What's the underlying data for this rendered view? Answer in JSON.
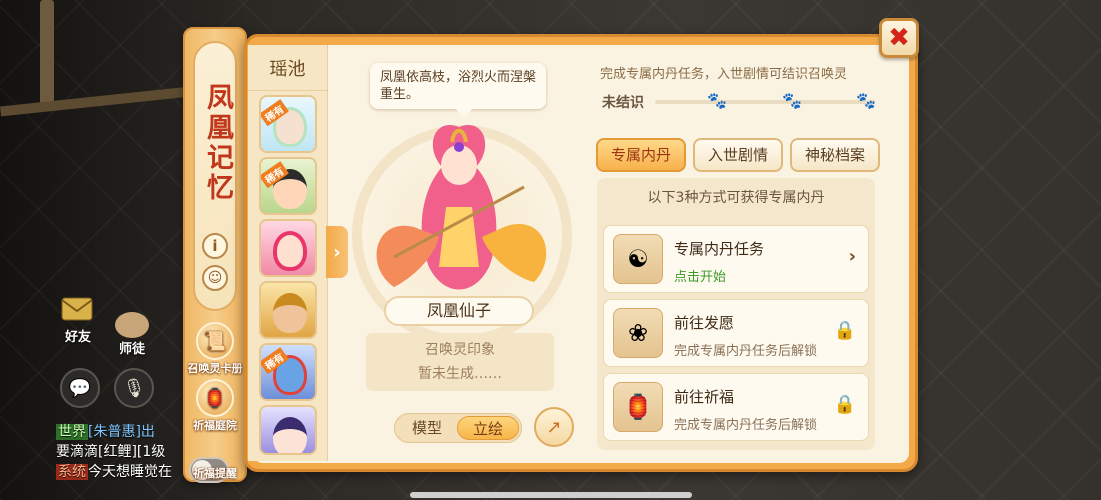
{
  "ribbon": {
    "title": "凤凰记忆",
    "info_icon": "i",
    "smile_icon": "☺",
    "card_label": "召唤灵卡册",
    "courtyard_label": "祈福庭院",
    "remind_label": "祈福提醒"
  },
  "pet_list": {
    "header": "瑶池",
    "rare_badge": "稀有"
  },
  "character": {
    "quote": "凤凰依高枝，浴烈火而涅槃重生。",
    "name": "凤凰仙子",
    "seal_title": "召唤灵印象",
    "seal_status": "暂未生成……",
    "view_model": "模型",
    "view_art": "立绘"
  },
  "bond": {
    "hint": "完成专属内丹任务，入世剧情可结识召唤灵",
    "state": "未结识"
  },
  "tabs": [
    "专属内丹",
    "入世剧情",
    "神秘档案"
  ],
  "methods": {
    "title": "以下3种方式可获得专属内丹",
    "items": [
      {
        "title": "专属内丹任务",
        "sub": "点击开始",
        "icon": "☯"
      },
      {
        "title": "前往发愿",
        "sub": "完成专属内丹任务后解锁",
        "icon": "❀"
      },
      {
        "title": "前往祈福",
        "sub": "完成专属内丹任务后解锁",
        "icon": "🏮"
      }
    ]
  },
  "hud": {
    "friends": "好友",
    "master": "师徒",
    "world_tag": "世界",
    "chat1": "[朱普惠]出",
    "chat2": "要滴滴[红鲤][1级",
    "system_tag": "系统",
    "chat3": "今天想睡觉在"
  },
  "colors": {
    "accent": "#f3a948",
    "close": "#d2261a",
    "active_tab": "#f7b24b"
  }
}
